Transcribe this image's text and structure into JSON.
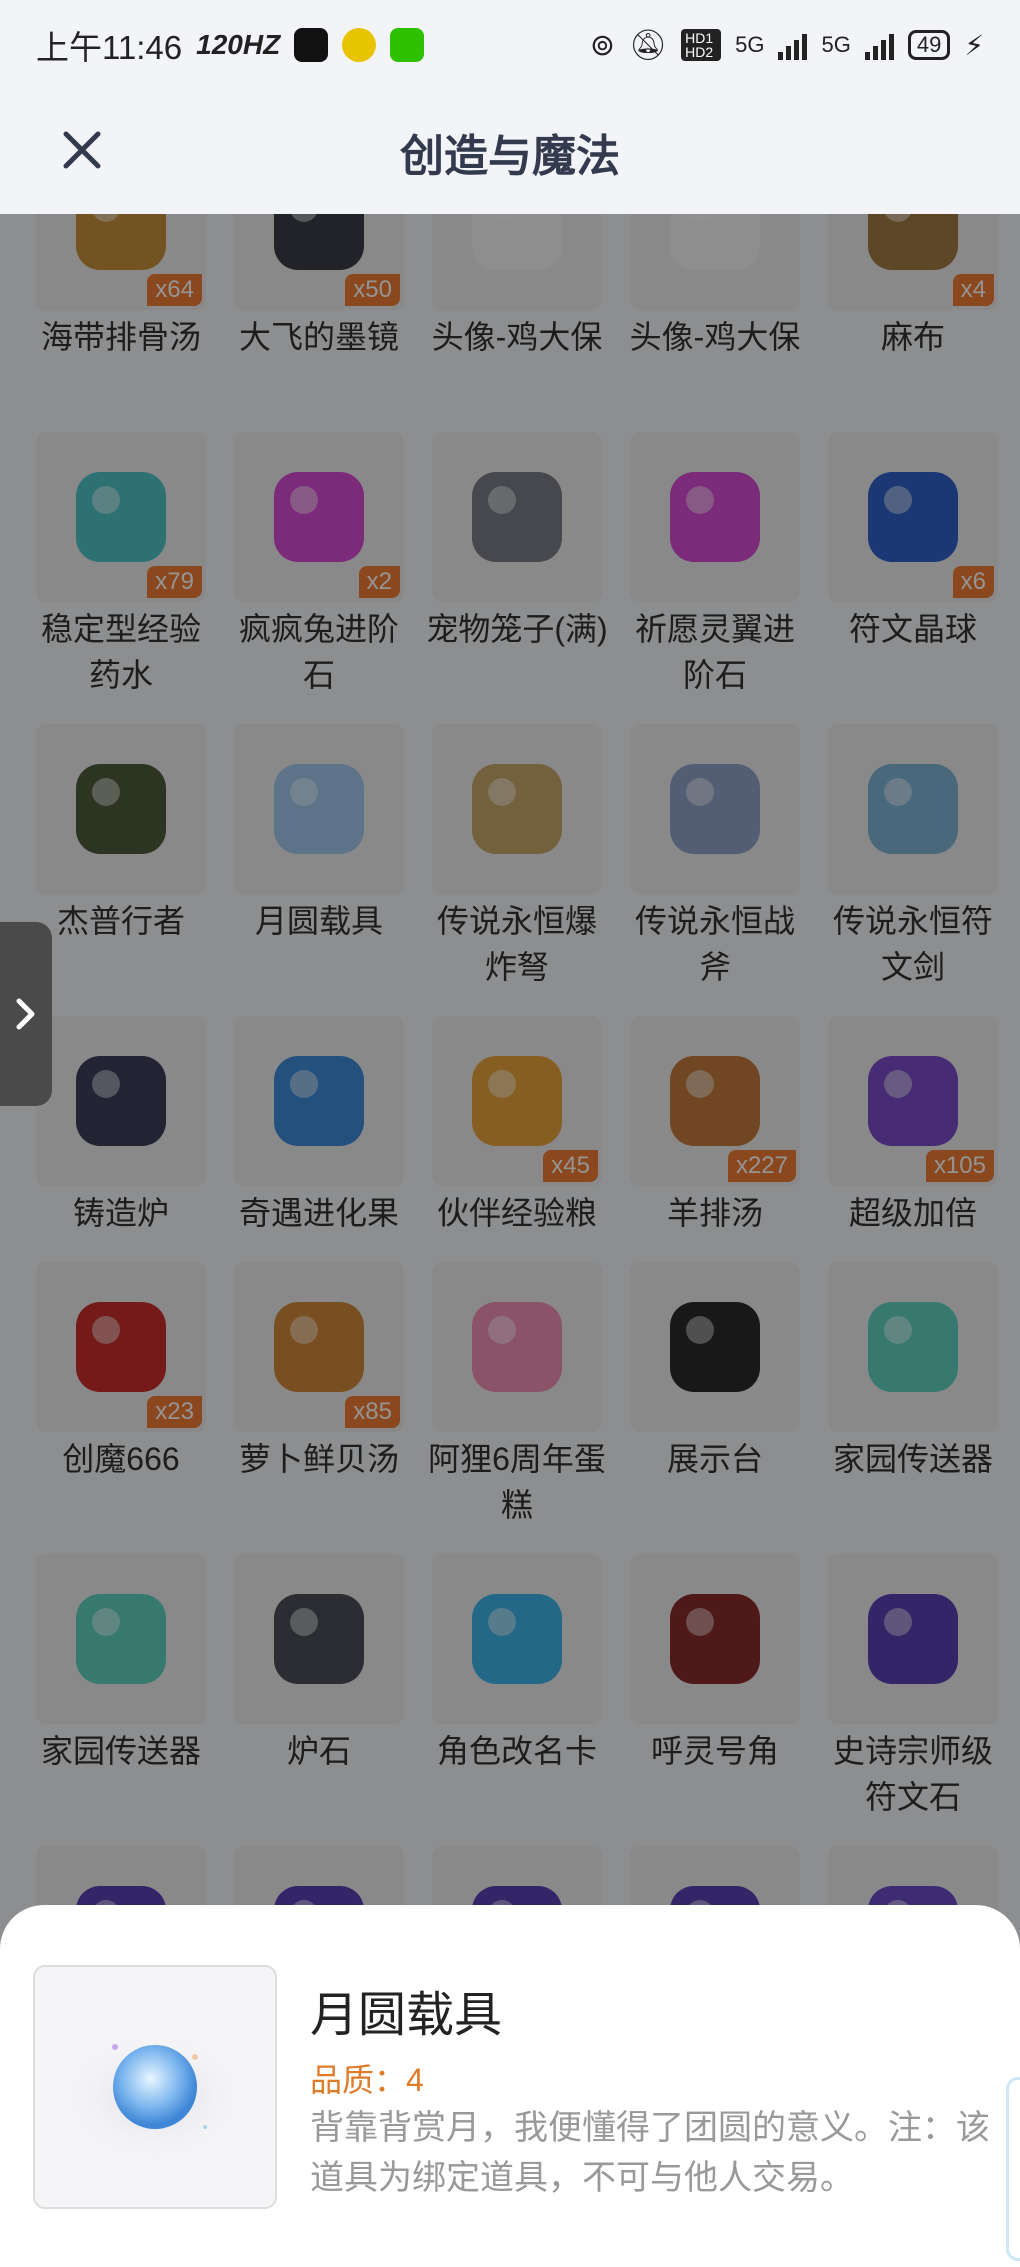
{
  "status_bar": {
    "time": "上午11:46",
    "refresh_rate": "120HZ",
    "network": [
      "5G",
      "5G"
    ],
    "hd_label": "HD1 HD2",
    "battery": "49"
  },
  "header": {
    "title": "创造与魔法"
  },
  "items": [
    {
      "name": "海带排骨汤",
      "count": "x64",
      "color": "#c98f3c",
      "icon": "soup-bowl-icon"
    },
    {
      "name": "大飞的墨镜",
      "count": "x50",
      "color": "#3a3d45",
      "icon": "sunglasses-icon"
    },
    {
      "name": "头像-鸡大保",
      "count": "",
      "color": "#f5f5f5",
      "icon": "avatar-frame-icon"
    },
    {
      "name": "头像-鸡大保",
      "count": "",
      "color": "#f5f5f5",
      "icon": "avatar-frame-icon"
    },
    {
      "name": "麻布",
      "count": "x4",
      "color": "#a27a44",
      "icon": "cloth-icon"
    },
    {
      "name": "稳定型经验药水",
      "count": "x79",
      "color": "#4ec3c7",
      "icon": "potion-icon"
    },
    {
      "name": "疯疯兔进阶石",
      "count": "x2",
      "color": "#d54bd0",
      "icon": "gem-icon"
    },
    {
      "name": "宠物笼子(满)",
      "count": "",
      "color": "#7a7d86",
      "icon": "pet-cage-icon"
    },
    {
      "name": "祈愿灵翼进阶石",
      "count": "",
      "color": "#d54bd0",
      "icon": "gem-icon"
    },
    {
      "name": "符文晶球",
      "count": "x6",
      "color": "#2f61c9",
      "icon": "orb-icon"
    },
    {
      "name": "杰普行者",
      "count": "",
      "color": "#4d5a3b",
      "icon": "jeep-icon"
    },
    {
      "name": "月圆载具",
      "count": "",
      "color": "#9fc7ee",
      "icon": "moon-vehicle-icon"
    },
    {
      "name": "传说永恒爆炸弩",
      "count": "",
      "color": "#c7a86b",
      "icon": "crossbow-icon"
    },
    {
      "name": "传说永恒战斧",
      "count": "",
      "color": "#8fa3c8",
      "icon": "axe-icon"
    },
    {
      "name": "传说永恒符文剑",
      "count": "",
      "color": "#7fb3d6",
      "icon": "sword-icon"
    },
    {
      "name": "铸造炉",
      "count": "",
      "color": "#3b3f5a",
      "icon": "furnace-icon"
    },
    {
      "name": "奇遇进化果",
      "count": "",
      "color": "#3f8ad8",
      "icon": "fruit-icon"
    },
    {
      "name": "伙伴经验粮",
      "count": "x45",
      "color": "#e8a23a",
      "icon": "food-bag-icon"
    },
    {
      "name": "羊排汤",
      "count": "x227",
      "color": "#c27a3c",
      "icon": "soup-bowl-icon"
    },
    {
      "name": "超级加倍",
      "count": "x105",
      "color": "#7a4bc9",
      "icon": "cards-icon"
    },
    {
      "name": "创魔666",
      "count": "x23",
      "color": "#c9302c",
      "icon": "red-card-icon"
    },
    {
      "name": "萝卜鲜贝汤",
      "count": "x85",
      "color": "#d0893a",
      "icon": "soup-bowl-icon"
    },
    {
      "name": "阿狸6周年蛋糕",
      "count": "",
      "color": "#f08fb4",
      "icon": "cake-icon"
    },
    {
      "name": "展示台",
      "count": "",
      "color": "#2a2a2a",
      "icon": "display-stand-icon"
    },
    {
      "name": "家园传送器",
      "count": "",
      "color": "#5fcfc0",
      "icon": "teleporter-icon"
    },
    {
      "name": "家园传送器",
      "count": "",
      "color": "#5fcfc0",
      "icon": "teleporter-icon"
    },
    {
      "name": "炉石",
      "count": "",
      "color": "#4a4f58",
      "icon": "hearthstone-icon"
    },
    {
      "name": "角色改名卡",
      "count": "",
      "color": "#3fb4e8",
      "icon": "rename-card-icon"
    },
    {
      "name": "呼灵号角",
      "count": "",
      "color": "#8a2c2c",
      "icon": "horn-icon"
    },
    {
      "name": "史诗宗师级符文石",
      "count": "",
      "color": "#5a3fb4",
      "icon": "rune-stone-icon"
    },
    {
      "name": "",
      "count": "",
      "color": "#5a3fb4",
      "icon": "rune-stone-icon"
    },
    {
      "name": "",
      "count": "",
      "color": "#5a3fb4",
      "icon": "rune-stone-icon"
    },
    {
      "name": "",
      "count": "",
      "color": "#5a3fb4",
      "icon": "rune-stone-icon"
    },
    {
      "name": "",
      "count": "",
      "color": "#5a3fb4",
      "icon": "rune-stone-icon"
    },
    {
      "name": "",
      "count": "",
      "color": "#6a4bc9",
      "icon": "card-icon"
    }
  ],
  "detail": {
    "name": "月圆载具",
    "quality": "品质：4",
    "description": "背靠背赏月，我便懂得了团圆的意义。注：该道具为绑定道具，不可与他人交易。",
    "icon": "moon-vehicle-icon",
    "color": "#9fc7ee"
  }
}
